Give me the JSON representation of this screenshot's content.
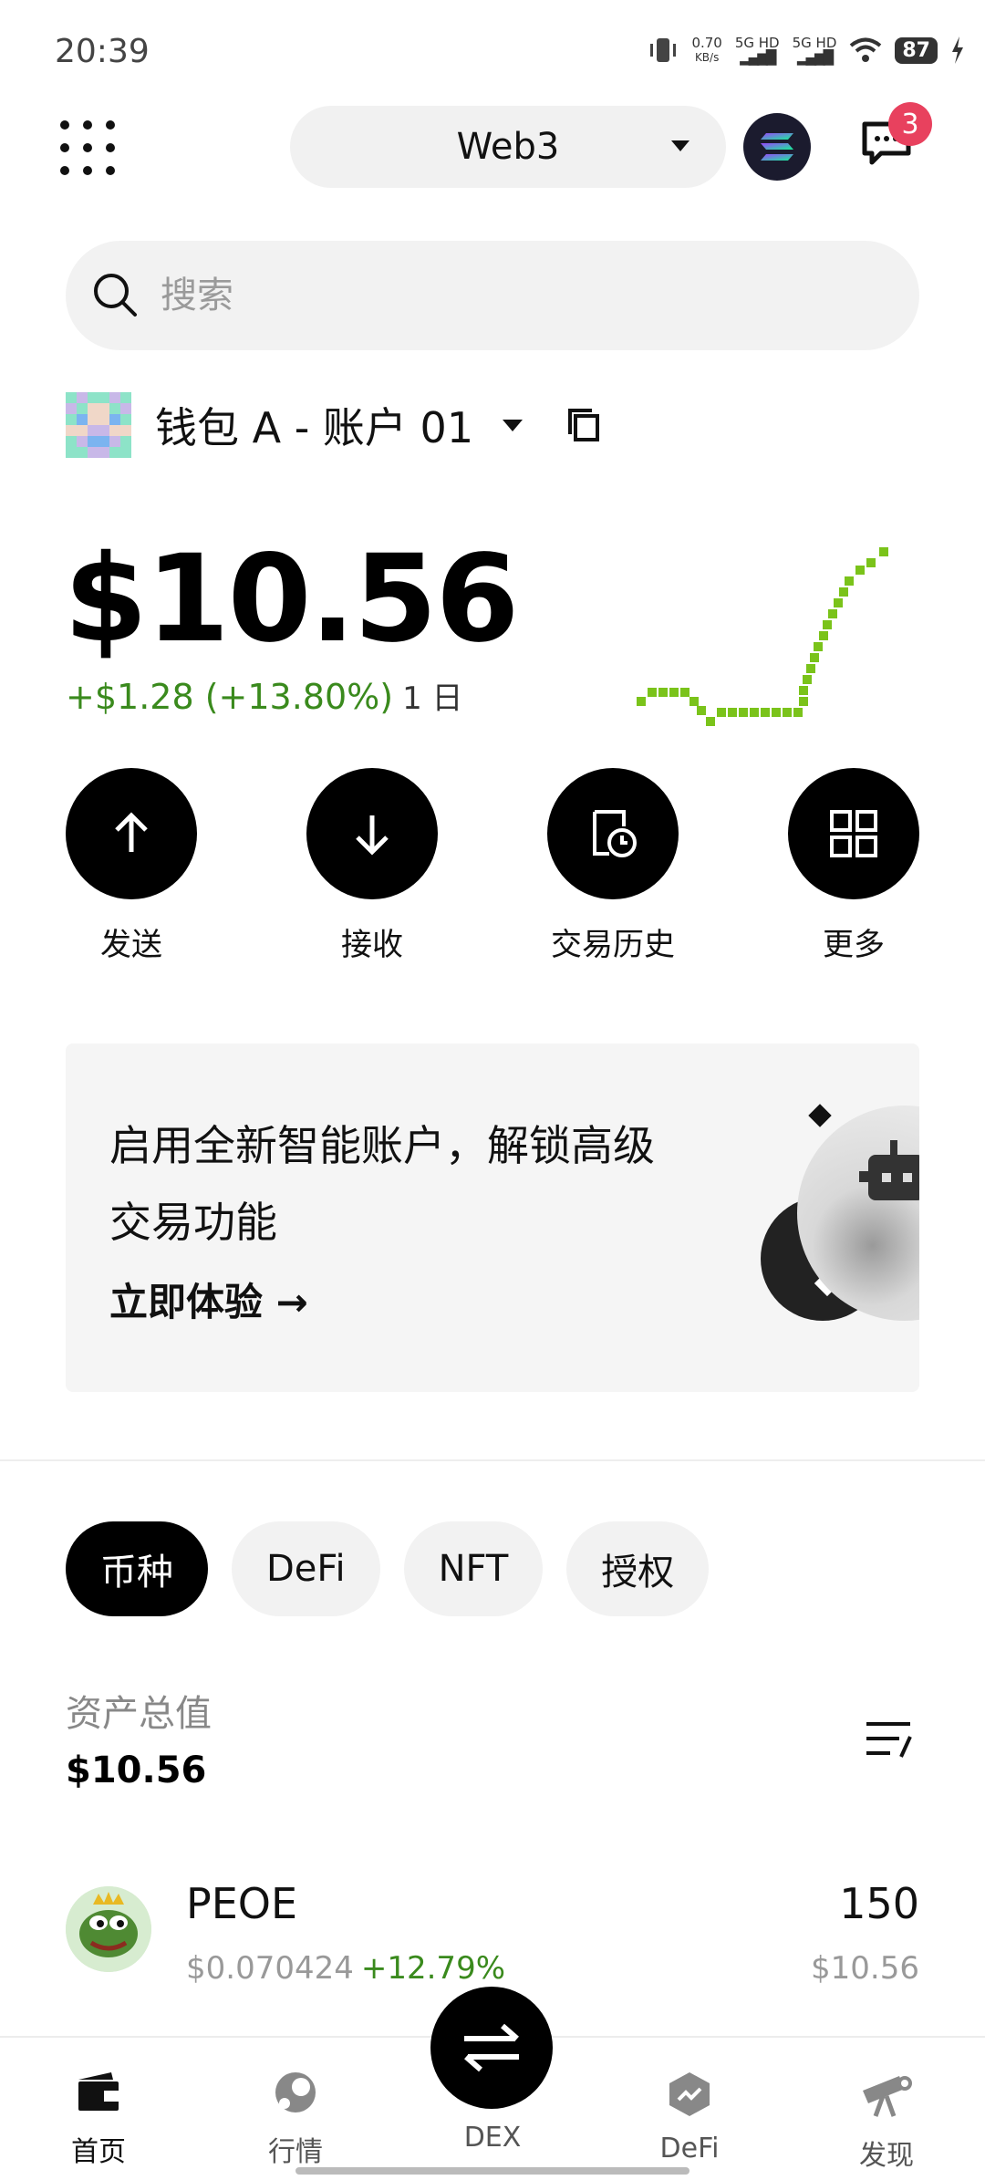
{
  "status_bar": {
    "time": "20:39",
    "speed_value": "0.70",
    "speed_unit": "KB/s",
    "sim1": "5G HD",
    "sim2": "5G HD",
    "battery": "87"
  },
  "header": {
    "network_label": "Web3",
    "notification_count": "3"
  },
  "search": {
    "placeholder": "搜索"
  },
  "wallet": {
    "name": "钱包 A - 账户 01"
  },
  "balance": {
    "amount": "$10.56",
    "change": "+$1.28 (+13.80%)",
    "period": "1 日"
  },
  "actions": [
    {
      "label": "发送",
      "icon": "arrow-up-icon"
    },
    {
      "label": "接收",
      "icon": "arrow-down-icon"
    },
    {
      "label": "交易历史",
      "icon": "history-icon"
    },
    {
      "label": "更多",
      "icon": "more-grid-icon"
    }
  ],
  "promo": {
    "text": "启用全新智能账户，解锁高级交易功能",
    "cta": "立即体验"
  },
  "tabs": [
    "币种",
    "DeFi",
    "NFT",
    "授权"
  ],
  "assets": {
    "label": "资产总值",
    "total": "$10.56",
    "tokens": [
      {
        "name": "PEOE",
        "price": "$0.070424",
        "change": "+12.79%",
        "amount": "150",
        "value": "$10.56"
      }
    ]
  },
  "bottom_nav": [
    {
      "label": "首页",
      "icon": "wallet-icon"
    },
    {
      "label": "行情",
      "icon": "market-icon"
    },
    {
      "label": "DEX",
      "icon": "swap-icon"
    },
    {
      "label": "DeFi",
      "icon": "defi-icon"
    },
    {
      "label": "发现",
      "icon": "telescope-icon"
    }
  ],
  "colors": {
    "positive": "#3a8a1d",
    "badge": "#e8415e",
    "sparkline": "#7ac31a"
  }
}
